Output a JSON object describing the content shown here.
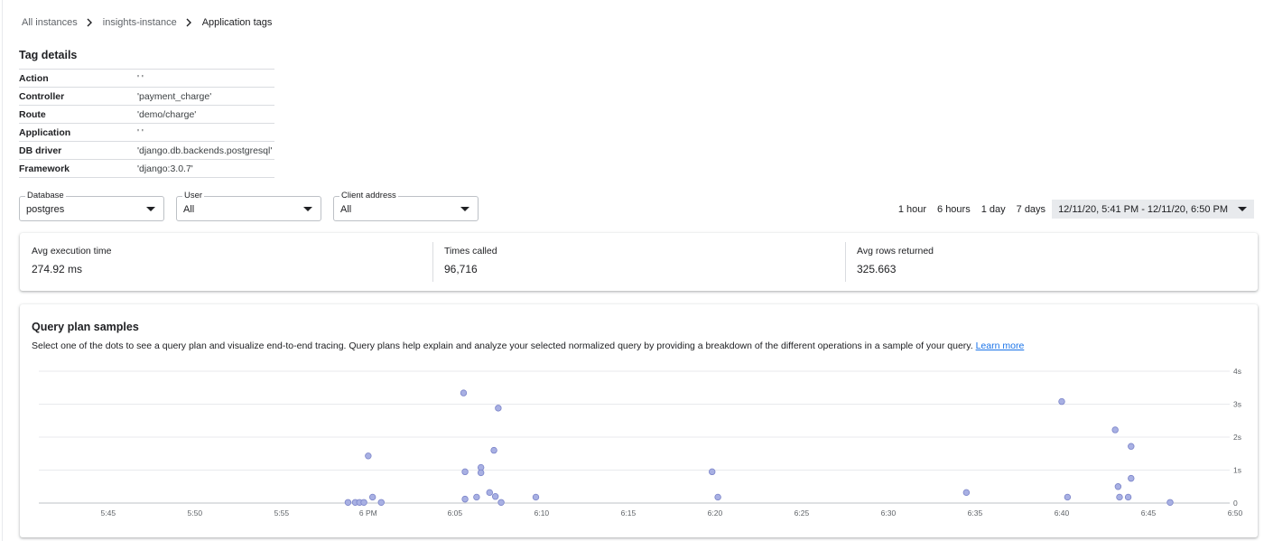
{
  "breadcrumb": {
    "items": [
      "All instances",
      "insights-instance"
    ],
    "current": "Application tags"
  },
  "tag_details": {
    "title": "Tag details",
    "rows": [
      {
        "key": "Action",
        "value": "' '"
      },
      {
        "key": "Controller",
        "value": "'payment_charge'"
      },
      {
        "key": "Route",
        "value": "'demo/charge'"
      },
      {
        "key": "Application",
        "value": "' '"
      },
      {
        "key": "DB driver",
        "value": "'django.db.backends.postgresql'"
      },
      {
        "key": "Framework",
        "value": "'django:3.0.7'"
      }
    ]
  },
  "filters": {
    "database": {
      "label": "Database",
      "value": "postgres"
    },
    "user": {
      "label": "User",
      "value": "All"
    },
    "client_address": {
      "label": "Client address",
      "value": "All"
    }
  },
  "time_range": {
    "options": [
      "1 hour",
      "6 hours",
      "1 day",
      "7 days"
    ],
    "selected": "12/11/20, 5:41 PM - 12/11/20, 6:50 PM"
  },
  "stats": {
    "avg_execution_time": {
      "label": "Avg execution time",
      "value": "274.92 ms"
    },
    "times_called": {
      "label": "Times called",
      "value": "96,716"
    },
    "avg_rows_returned": {
      "label": "Avg rows returned",
      "value": "325.663"
    }
  },
  "query_plan": {
    "title": "Query plan samples",
    "description": "Select one of the dots to see a query plan and visualize end-to-end tracing. Query plans help explain and analyze your selected normalized query by providing a breakdown of the different operations in a sample of your query.",
    "learn_more": "Learn more"
  },
  "chart_data": {
    "type": "scatter",
    "x_unit": "minutes",
    "xlim": [
      "5:41 PM",
      "6:50 PM"
    ],
    "ylim": [
      0,
      4
    ],
    "y_unit": "s",
    "x_tick_labels": [
      "5:45",
      "5:50",
      "5:55",
      "6 PM",
      "6:05",
      "6:10",
      "6:15",
      "6:20",
      "6:25",
      "6:30",
      "6:35",
      "6:40",
      "6:45",
      "6:50"
    ],
    "y_tick_labels": [
      "0",
      "1s",
      "2s",
      "3s",
      "4s"
    ],
    "grid": true,
    "dot_color": "#a8b0e3",
    "points": [
      {
        "x": "5:58:50 PM",
        "y": 0.02
      },
      {
        "x": "5:59:15 PM",
        "y": 0.02
      },
      {
        "x": "5:59:30 PM",
        "y": 0.02
      },
      {
        "x": "5:59:45 PM",
        "y": 0.02
      },
      {
        "x": "6:00:00 PM",
        "y": 1.43
      },
      {
        "x": "6:00:15 PM",
        "y": 0.18
      },
      {
        "x": "6:00:45 PM",
        "y": 0.02
      },
      {
        "x": "6:05:30 PM",
        "y": 3.34
      },
      {
        "x": "6:05:35 PM",
        "y": 0.95
      },
      {
        "x": "6:05:35 PM",
        "y": 0.12
      },
      {
        "x": "6:06:15 PM",
        "y": 0.18
      },
      {
        "x": "6:06:30 PM",
        "y": 1.08
      },
      {
        "x": "6:06:30 PM",
        "y": 0.92
      },
      {
        "x": "6:07:00 PM",
        "y": 0.32
      },
      {
        "x": "6:07:15 PM",
        "y": 1.6
      },
      {
        "x": "6:07:20 PM",
        "y": 0.2
      },
      {
        "x": "6:07:30 PM",
        "y": 2.88
      },
      {
        "x": "6:07:40 PM",
        "y": 0.02
      },
      {
        "x": "6:09:40 PM",
        "y": 0.18
      },
      {
        "x": "6:19:50 PM",
        "y": 0.95
      },
      {
        "x": "6:20:10 PM",
        "y": 0.18
      },
      {
        "x": "6:34:30 PM",
        "y": 0.32
      },
      {
        "x": "6:40:00 PM",
        "y": 3.08
      },
      {
        "x": "6:40:20 PM",
        "y": 0.18
      },
      {
        "x": "6:43:05 PM",
        "y": 2.22
      },
      {
        "x": "6:43:15 PM",
        "y": 0.5
      },
      {
        "x": "6:43:20 PM",
        "y": 0.18
      },
      {
        "x": "6:43:50 PM",
        "y": 0.18
      },
      {
        "x": "6:44:00 PM",
        "y": 1.72
      },
      {
        "x": "6:44:00 PM",
        "y": 0.75
      },
      {
        "x": "6:46:15 PM",
        "y": 0.02
      }
    ]
  }
}
